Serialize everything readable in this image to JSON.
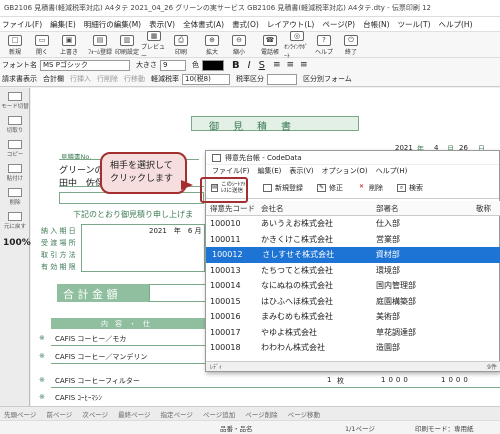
{
  "window": {
    "title": "GB2106 見積書(軽減税率対応) A4タテ 2021_04_26 グリーンの実サービス GB2106 見積書(軽減税率対応) A4タテ.dty - 伝票印刷 12"
  },
  "menubar": [
    "ファイル(F)",
    "編集(E)",
    "明細行の編集(M)",
    "表示(V)",
    "全体書式(A)",
    "書式(O)",
    "レイアウト(L)",
    "ページ(P)",
    "台帳(N)",
    "ツール(T)",
    "ヘルプ(H)"
  ],
  "toolbar1": [
    "新規",
    "開く",
    "上書き",
    "ﾌｫｰﾑ登録",
    "印刷設定",
    "プレビュー",
    "印刷",
    "拡大",
    "縮小",
    "電話帳",
    "ｵﾝﾗｲﾝｻﾎﾟｰﾄ",
    "ヘルプ",
    "終了"
  ],
  "toolbar2": {
    "font_label": "フォント名",
    "font": "MS Pゴシック",
    "size_label": "大きさ",
    "size": "9",
    "color_label": "色"
  },
  "toolbar3": {
    "items": [
      "請求書表示",
      "合計欄",
      "行挿入",
      "行削除",
      "行移動"
    ],
    "tax_label": "軽減税率",
    "tax_value": "10(税8)",
    "tax_kubun": "税率区分",
    "kubun_form": "区分別フォーム"
  },
  "leftpanel": [
    "モード切替",
    "切取り",
    "コピー",
    "貼付け",
    "削除",
    "元に戻す"
  ],
  "zoom": "100%",
  "document": {
    "title": "御　見　積　書",
    "date_year": "2021",
    "date_month": "4",
    "date_day": "26",
    "date_unit_y": "年",
    "date_unit_m": "月",
    "date_unit_d": "日",
    "estimate_no": "見積書No.",
    "customer": "グリーンの",
    "person": "田中　佐保",
    "phrase": "下記のとおり御見積り申し上げま",
    "fields": [
      "納 入 期 日",
      "受 渡 場 所",
      "取 引 方 法",
      "有 効 期 限"
    ],
    "delivery": "2021　年　6 月",
    "total_label": "合 計 金 額",
    "table_head": "内　容　・　仕",
    "items": [
      "CAFIS コーヒー／モカ",
      "CAFIS コーヒー／マンデリン",
      "CAFIS コーヒーフィルター",
      "CAFIS ｺｰﾋｰﾏｼﾝ"
    ],
    "qty": "1",
    "unit": "枚",
    "price": "1000",
    "amount": "1000",
    "star": "※"
  },
  "callout": {
    "text": "相手を選択して\nクリックします"
  },
  "dialog": {
    "title": "得意先台帳 - CodeData",
    "menu": [
      "ファイル(F)",
      "編集(E)",
      "表示(V)",
      "オプション(O)",
      "ヘルプ(H)"
    ],
    "tools": [
      "このｼｰﾄｱﾄﾞﾚｽに送信",
      "新規登録",
      "修正",
      "削除",
      "検索"
    ],
    "columns": [
      "得意先コード",
      "会社名",
      "部署名",
      "敬称"
    ],
    "rows": [
      [
        "100010",
        "あいうえお株式会社",
        "仕入部",
        ""
      ],
      [
        "100011",
        "かきくけこ株式会社",
        "営業部",
        ""
      ],
      [
        "100012",
        "さしすせそ株式会社",
        "資材部",
        ""
      ],
      [
        "100013",
        "たちつてと株式会社",
        "環境部",
        ""
      ],
      [
        "100014",
        "なにぬねの株式会社",
        "国内管理部",
        ""
      ],
      [
        "100015",
        "はひふへほ株式会社",
        "庭園構築部",
        ""
      ],
      [
        "100016",
        "まみむめも株式会社",
        "美術部",
        ""
      ],
      [
        "100017",
        "やゆよ株式会社",
        "草花調達部",
        ""
      ],
      [
        "100018",
        "わわわん株式会社",
        "造園部",
        ""
      ]
    ],
    "selected_row": 2,
    "status_left": "ﾚﾃﾞｨ",
    "status_right": "9件"
  },
  "statusbar": [
    "先頭ページ",
    "前ページ",
    "次ページ",
    "最終ページ",
    "指定ページ",
    "ページ追加",
    "ページ削除",
    "ページ移動"
  ],
  "footer": {
    "center": "品番・品名",
    "page": "1/1ページ",
    "mode": "印刷モード：専用紙"
  },
  "colors": {
    "accent": "#1e74d4",
    "callout_border": "#a42f2f",
    "doc_green": "#7ba889"
  }
}
